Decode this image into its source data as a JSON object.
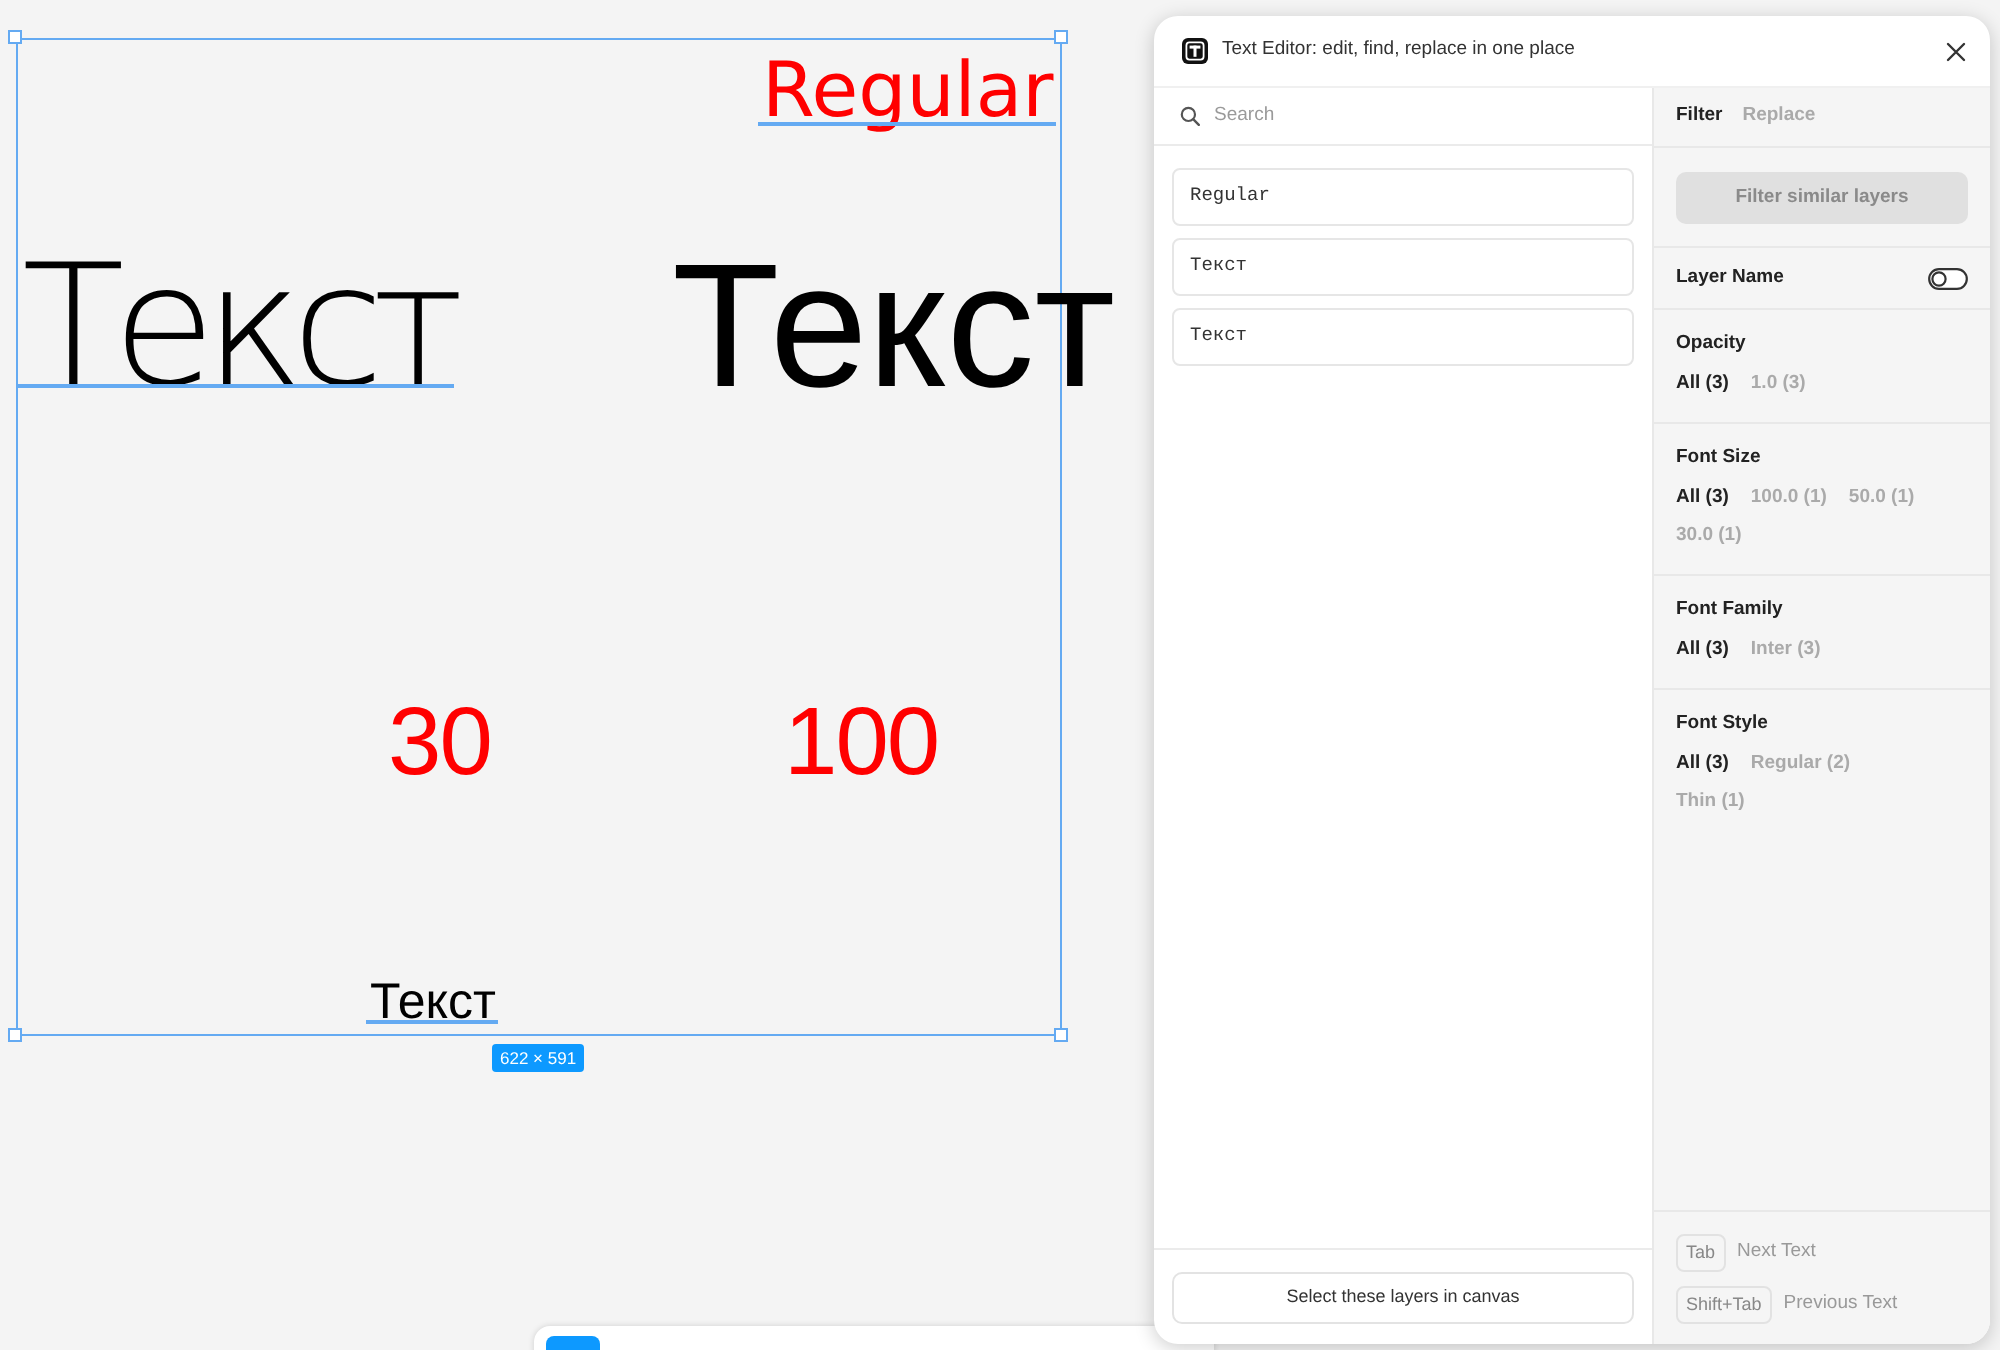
{
  "canvas": {
    "items": [
      {
        "text": "Regular",
        "color": "#ff0000",
        "selected": true
      },
      {
        "text": "Текст",
        "color": "#000000",
        "selected": true
      },
      {
        "text": "Текст",
        "color": "#000000",
        "selected": false
      },
      {
        "text": "30",
        "color": "#ff0000",
        "selected": false
      },
      {
        "text": "100",
        "color": "#ff0000",
        "selected": false
      },
      {
        "text": "Текст",
        "color": "#000000",
        "selected": true
      }
    ],
    "selection": {
      "size_label": "622 × 591"
    }
  },
  "panel": {
    "title": "Text Editor: edit, find, replace in one place",
    "search": {
      "placeholder": "Search"
    },
    "layers": [
      "Regular",
      "Текст",
      "Текст"
    ],
    "select_button": "Select these layers in canvas",
    "tabs": [
      {
        "label": "Filter",
        "selected": true
      },
      {
        "label": "Replace",
        "selected": false
      }
    ],
    "filter_button": {
      "label": "Filter similar layers",
      "disabled": true
    },
    "layer_name": {
      "label": "Layer Name",
      "on": false
    },
    "filters": [
      {
        "title": "Opacity",
        "options": [
          {
            "label": "All (3)",
            "selected": true
          },
          {
            "label": "1.0 (3)",
            "selected": false
          }
        ]
      },
      {
        "title": "Font Size",
        "options": [
          {
            "label": "All (3)",
            "selected": true
          },
          {
            "label": "100.0 (1)",
            "selected": false
          },
          {
            "label": "50.0 (1)",
            "selected": false
          },
          {
            "label": "30.0 (1)",
            "selected": false
          }
        ]
      },
      {
        "title": "Font Family",
        "options": [
          {
            "label": "All (3)",
            "selected": true
          },
          {
            "label": "Inter (3)",
            "selected": false
          }
        ]
      },
      {
        "title": "Font Style",
        "options": [
          {
            "label": "All (3)",
            "selected": true
          },
          {
            "label": "Regular (2)",
            "selected": false
          },
          {
            "label": "Thin (1)",
            "selected": false
          }
        ]
      }
    ],
    "shortcuts": [
      {
        "key": "Tab",
        "action": "Next Text"
      },
      {
        "key": "Shift+Tab",
        "action": "Previous Text"
      }
    ]
  }
}
